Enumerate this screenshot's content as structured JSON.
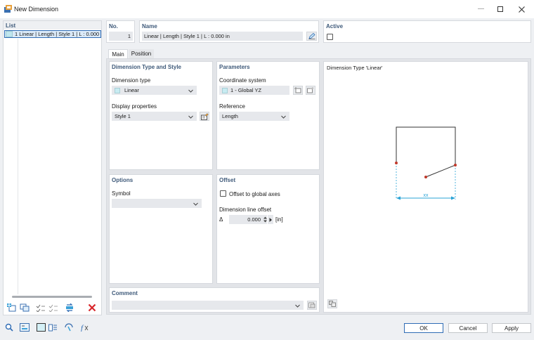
{
  "window": {
    "title": "New Dimension"
  },
  "list": {
    "header": "List",
    "items": [
      {
        "label": "1  Linear | Length | Style 1 | L : 0.000 in"
      }
    ]
  },
  "top": {
    "no_label": "No.",
    "no_value": "1",
    "name_label": "Name",
    "name_value": "Linear | Length | Style 1 | L : 0.000 in",
    "active_label": "Active"
  },
  "tabs": [
    {
      "label": "Main"
    },
    {
      "label": "Position"
    }
  ],
  "dimension_type_style": {
    "title": "Dimension Type and Style",
    "type_label": "Dimension type",
    "type_value": "Linear",
    "display_label": "Display properties",
    "display_value": "Style 1"
  },
  "parameters": {
    "title": "Parameters",
    "coord_label": "Coordinate system",
    "coord_value": "1 - Global YZ",
    "reference_label": "Reference",
    "reference_value": "Length"
  },
  "options": {
    "title": "Options",
    "symbol_label": "Symbol",
    "symbol_value": ""
  },
  "offset": {
    "title": "Offset",
    "global_axes_label": "Offset to global axes",
    "line_offset_label": "Dimension line offset",
    "delta_symbol": "Δ",
    "line_offset_value": "0.000",
    "unit": "[in]"
  },
  "comment": {
    "title": "Comment",
    "value": ""
  },
  "preview": {
    "title": "Dimension Type 'Linear'",
    "dim_label": "xx"
  },
  "footer": {
    "ok": "OK",
    "cancel": "Cancel",
    "apply": "Apply"
  },
  "colors": {
    "accent_blue": "#2f6cb5",
    "section_title": "#3f5a7a",
    "dimension_line": "#29a3d6",
    "point": "#c0392b",
    "delete_red": "#d8262b"
  }
}
